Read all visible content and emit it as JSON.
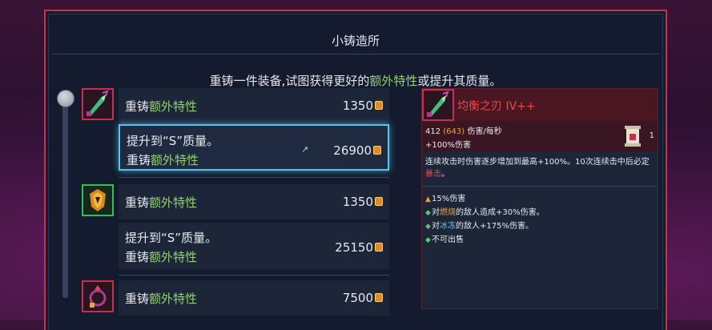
{
  "dialog": {
    "title": "小铸造所",
    "subtitle_parts": [
      "重铸一件装备,试图获得更好的",
      "额外特性",
      "或提升其质量。"
    ]
  },
  "rows": [
    {
      "prefix": "重铸",
      "highlight": "额外特性",
      "price": "1350"
    },
    {
      "line1": "提升到“S”质量。",
      "prefix": "重铸",
      "highlight": "额外特性",
      "price": "26900"
    },
    {
      "prefix": "重铸",
      "highlight": "额外特性",
      "price": "1350"
    },
    {
      "line1": "提升到“S”质量。",
      "prefix": "重铸",
      "highlight": "额外特性",
      "price": "25150"
    },
    {
      "prefix": "重铸",
      "highlight": "额外特性",
      "price": "7500"
    }
  ],
  "detail": {
    "name": "均衡之刃 IV++",
    "stat_damage": "412",
    "stat_dps": "(643)",
    "stat_damage_label": "伤害/每秒",
    "stat_bonus": "+100%伤害",
    "scroll_count": "1",
    "desc_prefix": "连续攻击时伤害逐步增加到最高+100%。10次连续击中后必定",
    "desc_crit": "暴击",
    "desc_suffix": "。",
    "affixes": [
      {
        "text": "15%伤害",
        "icon": "up-arrow-icon"
      },
      {
        "pre": "对",
        "key": "燃烧",
        "post": "的敌人造成+30%伤害。",
        "icon": "diamond-icon"
      },
      {
        "pre": "对",
        "key": "冰冻",
        "post": "的敌人+175%伤害。",
        "icon": "diamond-icon"
      },
      {
        "text": "不可出售",
        "icon": "diamond-icon"
      }
    ]
  },
  "colors": {
    "accent_red": "#c7314f",
    "highlight_green": "#8fd36a",
    "select_blue": "#52c6ee",
    "coin_orange": "#e08a2a"
  }
}
